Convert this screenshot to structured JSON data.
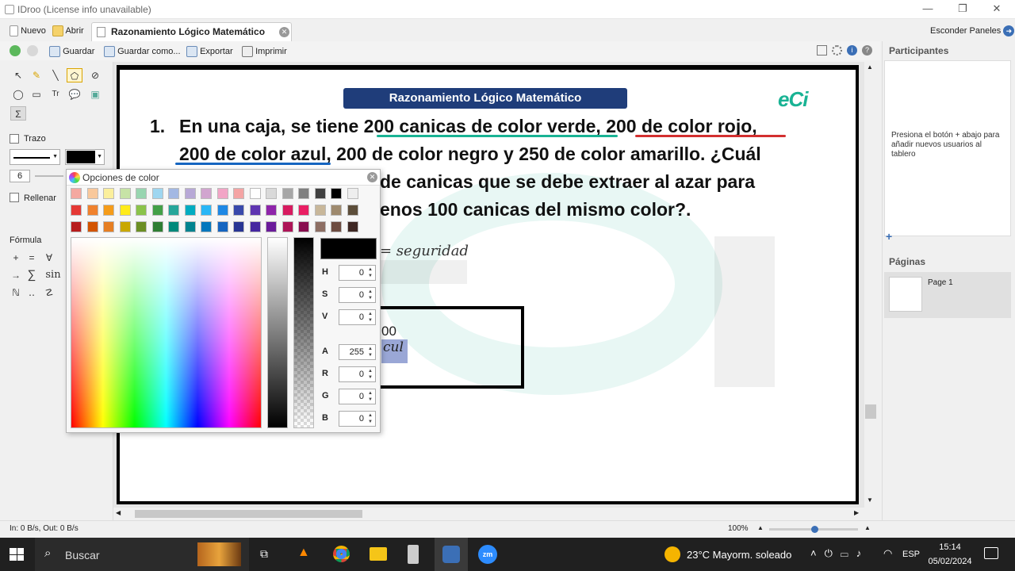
{
  "window": {
    "title": "IDroo (License info unavailable)"
  },
  "tabs": {
    "new_label": "Nuevo",
    "open_label": "Abrir",
    "doc_title": "Razonamiento Lógico Matemático",
    "hide_panels": "Esconder Paneles"
  },
  "toolbar": {
    "save": "Guardar",
    "save_as": "Guardar como...",
    "export": "Exportar",
    "print": "Imprimir"
  },
  "left_panel": {
    "trazo": "Trazo",
    "stroke_size": "6",
    "rellenar": "Rellenar",
    "formula": "Fórmula",
    "math_sym_1": "sin",
    "math_sym_2": "ℕ"
  },
  "board": {
    "banner": "Razonamiento Lógico Matemático",
    "logo_text": "eCi",
    "q_number": "1.",
    "q_line1": "En una caja, se tiene 200 canicas de color verde, 200 de color rojo,",
    "q_line2": "200 de color azul, 200 de color negro y 250 de color amarillo. ¿Cuál",
    "q_line3": "de canicas que se debe extraer al azar para",
    "q_line4": "enos 100 canicas del mismo color?.",
    "formula_text": "= seguridad",
    "box_text1": "00",
    "box_text2": "cul"
  },
  "color_dialog": {
    "title": "Opciones de color",
    "fields": [
      {
        "label": "H",
        "value": "0"
      },
      {
        "label": "S",
        "value": "0"
      },
      {
        "label": "V",
        "value": "0"
      },
      {
        "label": "A",
        "value": "255"
      },
      {
        "label": "R",
        "value": "0"
      },
      {
        "label": "G",
        "value": "0"
      },
      {
        "label": "B",
        "value": "0"
      }
    ],
    "swatch_row1": [
      "#f4a8a0",
      "#f9c89b",
      "#fbef9c",
      "#c7e3a6",
      "#98d5b0",
      "#9ed6f0",
      "#a3b8e3",
      "#b7a8d6",
      "#d1a5cf",
      "#f2a5c6",
      "#f4a4a4",
      "#ffffff",
      "#d9d9d9",
      "#a6a6a6",
      "#7f7f7f",
      "#404040",
      "#000000",
      "#eeeeee"
    ],
    "swatch_row2": [
      "#e53935",
      "#f0822e",
      "#f59c1a",
      "#ffeb1a",
      "#8bc34a",
      "#43a047",
      "#26a69a",
      "#00acc1",
      "#29b6f6",
      "#1e88e5",
      "#3949ab",
      "#5e35b1",
      "#8e24aa",
      "#d81b60",
      "#e91e63",
      "#c8b79a",
      "#9e8a6e",
      "#5d4e3a"
    ],
    "swatch_row3": [
      "#b71c1c",
      "#d35400",
      "#e67e22",
      "#c9a800",
      "#6b8e23",
      "#2e7d32",
      "#00897b",
      "#00838f",
      "#0277bd",
      "#1565c0",
      "#283593",
      "#4527a0",
      "#6a1b9a",
      "#ad1457",
      "#880e4f",
      "#8d6e63",
      "#6d4c41",
      "#3e2723"
    ],
    "current_color": "#000000"
  },
  "right_panel": {
    "participants_title": "Participantes",
    "participants_hint": "Presiona el botón + abajo para añadir nuevos usuarios al tablero",
    "pages_title": "Páginas",
    "page1": "Page 1"
  },
  "status": {
    "traffic": "In: 0 B/s, Out: 0 B/s",
    "zoom": "100%"
  },
  "taskbar": {
    "search": "Buscar",
    "weather": "23°C  Mayorm. soleado",
    "lang": "ESP",
    "time": "15:14",
    "date": "05/02/2024"
  },
  "colors": {
    "banner_bg": "#1f3d7a",
    "accent_green": "#19b394",
    "accent_red": "#d32f2f",
    "accent_blue": "#1565c0"
  }
}
